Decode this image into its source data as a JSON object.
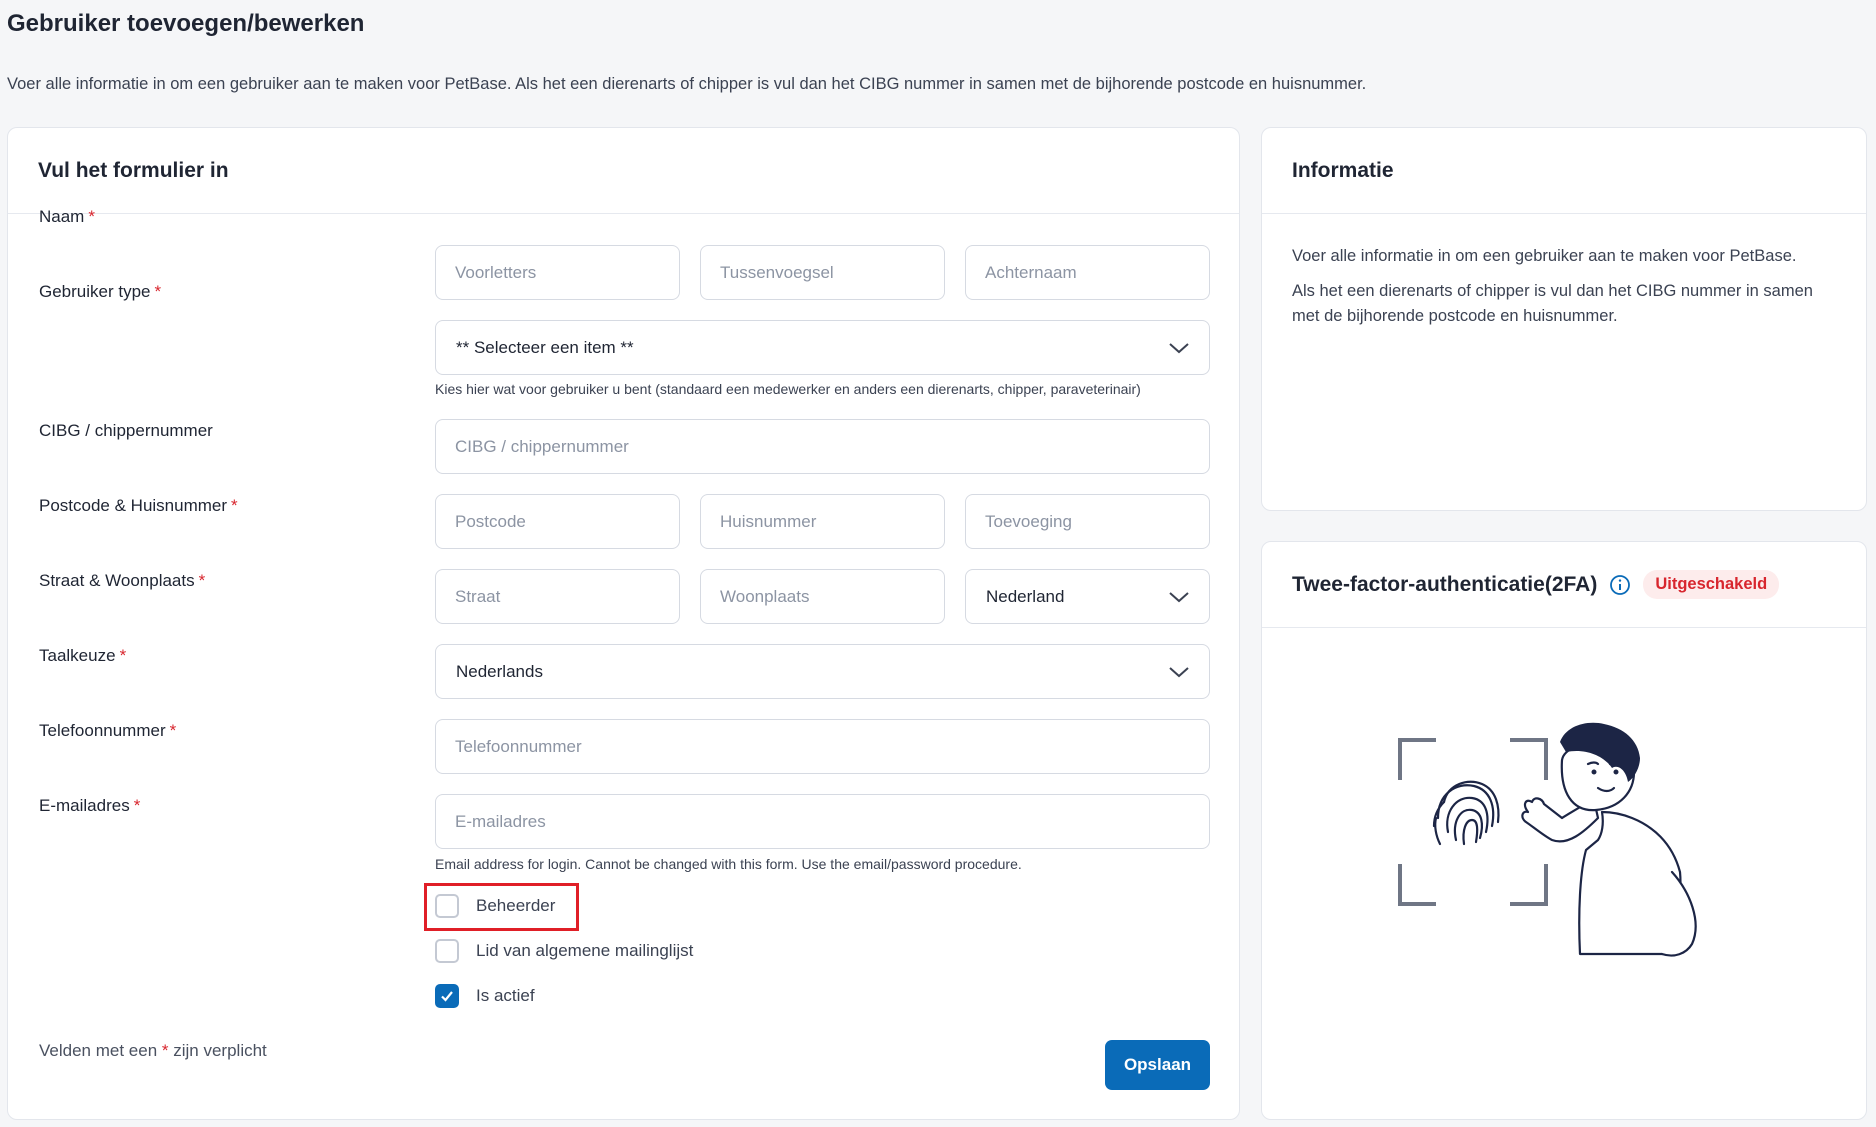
{
  "page": {
    "title": "Gebruiker toevoegen/bewerken",
    "subtitle": "Voer alle informatie in om een gebruiker aan te maken voor PetBase. Als het een dierenarts of chipper is vul dan het CIBG nummer in samen met de bijhorende postcode en huisnummer."
  },
  "form": {
    "title": "Vul het formulier in",
    "required_mark": "*",
    "fields": {
      "naam": {
        "label": "Naam",
        "voorletters_placeholder": "Voorletters",
        "tussenvoegsel_placeholder": "Tussenvoegsel",
        "achternaam_placeholder": "Achternaam"
      },
      "gebruiker_type": {
        "label": "Gebruiker type",
        "selected": "** Selecteer een item **",
        "help": "Kies hier wat voor gebruiker u bent (standaard een medewerker en anders een dierenarts, chipper, paraveterinair)"
      },
      "cibg": {
        "label": "CIBG / chippernummer",
        "placeholder": "CIBG / chippernummer"
      },
      "postcode": {
        "label": "Postcode & Huisnummer",
        "postcode_placeholder": "Postcode",
        "huisnummer_placeholder": "Huisnummer",
        "toevoeging_placeholder": "Toevoeging"
      },
      "straat": {
        "label": "Straat & Woonplaats",
        "straat_placeholder": "Straat",
        "woonplaats_placeholder": "Woonplaats",
        "land_selected": "Nederland"
      },
      "taal": {
        "label": "Taalkeuze",
        "selected": "Nederlands"
      },
      "telefoon": {
        "label": "Telefoonnummer",
        "placeholder": "Telefoonnummer"
      },
      "email": {
        "label": "E-mailadres",
        "placeholder": "E-mailadres",
        "help": "Email address for login. Cannot be changed with this form. Use the email/password procedure."
      }
    },
    "checkboxes": {
      "beheerder": {
        "label": "Beheerder",
        "checked": false
      },
      "mailinglijst": {
        "label": "Lid van algemene mailinglijst",
        "checked": false
      },
      "actief": {
        "label": "Is actief",
        "checked": true
      }
    },
    "footnote_before": "Velden met een",
    "footnote_after": "zijn verplicht",
    "save_label": "Opslaan"
  },
  "info": {
    "title": "Informatie",
    "paragraph1": "Voer alle informatie in om een gebruiker aan te maken voor PetBase.",
    "paragraph2": "Als het een dierenarts of chipper is vul dan het CIBG nummer in samen met de bijhorende postcode en huisnummer."
  },
  "tfa": {
    "title": "Twee-factor-authenticatie(2FA)",
    "status": "Uitgeschakeld"
  },
  "colors": {
    "primary": "#0a6bb8",
    "required": "#d8262e",
    "highlight": "#e01f27",
    "badge_bg": "#fdecec"
  },
  "icons": {
    "select_chevron": "chevron-down-icon",
    "info": "info-circle-icon",
    "checkmark": "check-icon",
    "illustration": "fingerprint-scan-illustration"
  }
}
